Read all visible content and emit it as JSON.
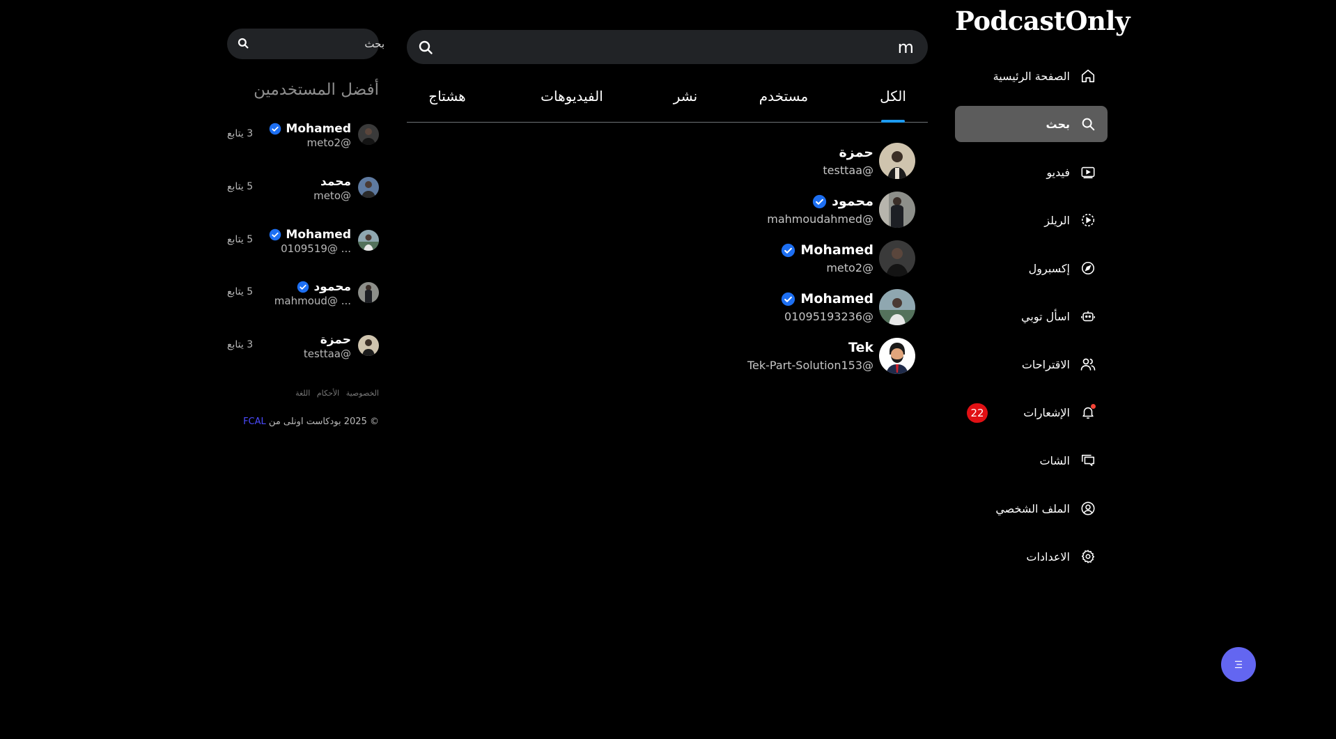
{
  "app": {
    "logo": "PodcastOnly"
  },
  "sidebar": {
    "items": [
      {
        "label": "الصفحة الرئيسية",
        "icon": "home-icon"
      },
      {
        "label": "بحث",
        "icon": "search-icon",
        "active": true
      },
      {
        "label": "فيديو",
        "icon": "video-icon"
      },
      {
        "label": "الريلز",
        "icon": "reels-icon"
      },
      {
        "label": "إكسبرول",
        "icon": "compass-icon"
      },
      {
        "label": "اسأل توبي",
        "icon": "robot-icon"
      },
      {
        "label": "الاقتراحات",
        "icon": "users-icon"
      },
      {
        "label": "الإشعارات",
        "icon": "bell-icon",
        "badge": "22"
      },
      {
        "label": "الشات",
        "icon": "chat-icon"
      },
      {
        "label": "الملف الشخصي",
        "icon": "profile-icon"
      },
      {
        "label": "الاعدادات",
        "icon": "gear-icon"
      }
    ]
  },
  "search": {
    "value": "m"
  },
  "tabs": [
    {
      "label": "الكل",
      "active": true
    },
    {
      "label": "مستخدم"
    },
    {
      "label": "نشر"
    },
    {
      "label": "الفيديوهات"
    },
    {
      "label": "هشتاج"
    }
  ],
  "results": [
    {
      "name": "حمزة",
      "handle": "testtaa@",
      "verified": false
    },
    {
      "name": "محمود",
      "handle": "mahmoudahmed@",
      "verified": true
    },
    {
      "name": "Mohamed",
      "handle": "meto2@",
      "verified": true
    },
    {
      "name": "Mohamed",
      "handle": "01095193236@",
      "verified": true
    },
    {
      "name": "Tek",
      "handle": "Tek-Part-Solution153@",
      "verified": false
    }
  ],
  "side_search": {
    "placeholder": "بحث"
  },
  "top_users": {
    "title": "أفضل المستخدمين",
    "users": [
      {
        "name": "Mohamed",
        "handle": "meto2@",
        "followers": "3 يتابع",
        "verified": true
      },
      {
        "name": "محمد",
        "handle": "meto@",
        "followers": "5 يتابع",
        "verified": false
      },
      {
        "name": "Mohamed",
        "handle": "0109519@ ...",
        "followers": "5 يتابع",
        "verified": true
      },
      {
        "name": "محمود",
        "handle": "mahmoud@ ...",
        "followers": "5 يتابع",
        "verified": true
      },
      {
        "name": "حمزة",
        "handle": "testtaa@",
        "followers": "3 يتابع",
        "verified": false
      }
    ]
  },
  "footer": {
    "links": [
      "الخصوصية",
      "الأحكام",
      "اللغة"
    ],
    "copyright_prefix": "© 2025 بودكاست اونلى من",
    "copyright_brand": "FCAL"
  },
  "colors": {
    "accent": "#1d9bf0",
    "verified": "#1d6ff2",
    "badge": "#e11014",
    "fab": "#6366f1",
    "active_nav": "#5c5c5c"
  }
}
